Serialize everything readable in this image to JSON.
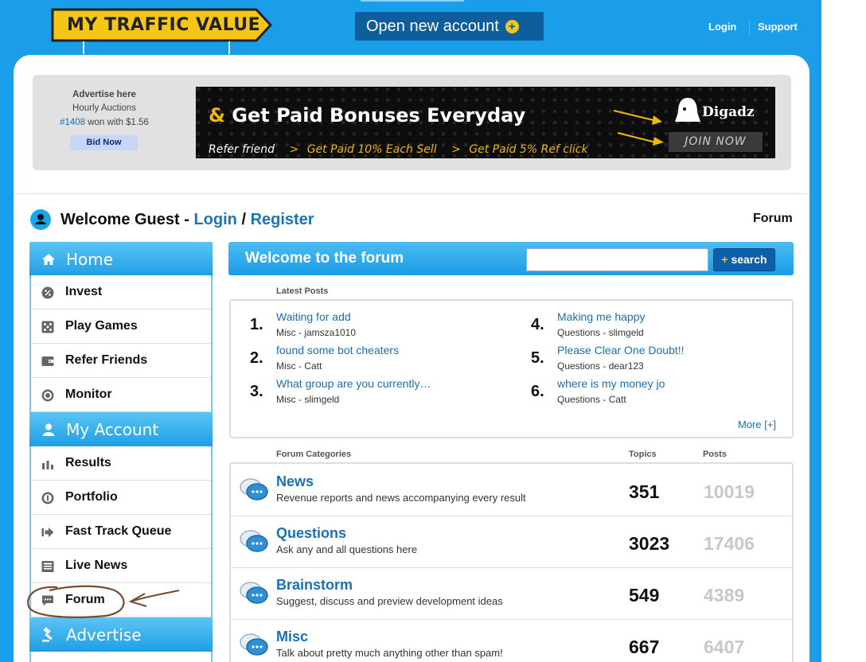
{
  "header": {
    "logo_text": "MY TRAFFIC VALUE",
    "open_account_label": "Open new account",
    "open_account_plus": "+",
    "login_label": "Login",
    "support_label": "Support"
  },
  "ad_panel": {
    "title": "Advertise here",
    "subtitle": "Hourly Auctions",
    "auction_id": "#1408",
    "auction_text": " won with $1.56",
    "bid_label": "Bid Now",
    "banner": {
      "amp": "&",
      "headline": " Get Paid Bonuses Everyday",
      "sub_1": "Refer friend",
      "sub_arrow": ">",
      "sub_2": "Get Paid 10% Each Sell",
      "sub_3": "Get Paid 5% Ref click",
      "brand": "Digadz",
      "join_label": "JOIN NOW"
    }
  },
  "welcome": {
    "text": "Welcome Guest - ",
    "login_link": "Login",
    "sep": " / ",
    "register_link": "Register",
    "breadcrumb": "Forum"
  },
  "sidebar": {
    "home_label": "Home",
    "home_items": [
      {
        "label": "Invest",
        "icon": "percent-icon"
      },
      {
        "label": "Play Games",
        "icon": "dice-icon"
      },
      {
        "label": "Refer Friends",
        "icon": "wallet-icon"
      },
      {
        "label": "Monitor",
        "icon": "target-icon"
      }
    ],
    "account_label": "My Account",
    "account_items": [
      {
        "label": "Results",
        "icon": "bar-chart-icon"
      },
      {
        "label": "Portfolio",
        "icon": "info-circle-icon"
      },
      {
        "label": "Fast Track Queue",
        "icon": "arrow-right-icon"
      },
      {
        "label": "Live News",
        "icon": "newspaper-icon"
      },
      {
        "label": "Forum",
        "icon": "chat-bubble-icon"
      }
    ],
    "advertise_label": "Advertise"
  },
  "forum": {
    "title": "Welcome to the forum",
    "search_placeholder": "",
    "search_plus": "+",
    "search_label": "search",
    "latest_label": "Latest Posts",
    "latest_posts": [
      {
        "num": "1.",
        "title": "Waiting for add",
        "meta": "Misc - jamsza1010"
      },
      {
        "num": "2.",
        "title": "found some bot cheaters",
        "meta": "Misc - Catt"
      },
      {
        "num": "3.",
        "title": "What group are you currently…",
        "meta": "Misc - slimgeld"
      },
      {
        "num": "4.",
        "title": "Making me happy",
        "meta": "Questions - slimgeld"
      },
      {
        "num": "5.",
        "title": "Please Clear One Doubt!!",
        "meta": "Questions - dear123"
      },
      {
        "num": "6.",
        "title": "where is my money jo",
        "meta": "Questions - Catt"
      }
    ],
    "more_label": "More [+]",
    "categories_label": "Forum Categories",
    "topics_label": "Topics",
    "posts_label": "Posts",
    "categories": [
      {
        "name": "News",
        "desc": "Revenue reports and news accompanying every result",
        "topics": "351",
        "posts": "10019"
      },
      {
        "name": "Questions",
        "desc": "Ask any and all questions here",
        "topics": "3023",
        "posts": "17406"
      },
      {
        "name": "Brainstorm",
        "desc": "Suggest, discuss and preview development ideas",
        "topics": "549",
        "posts": "4389"
      },
      {
        "name": "Misc",
        "desc": "Talk about pretty much anything other than spam!",
        "topics": "667",
        "posts": "6407"
      }
    ]
  },
  "colors": {
    "page_blue": "#1a9eea",
    "link_blue": "#1a6fb5",
    "accent_yellow": "#f5c518",
    "annotation_brown": "#7a4a2a"
  }
}
